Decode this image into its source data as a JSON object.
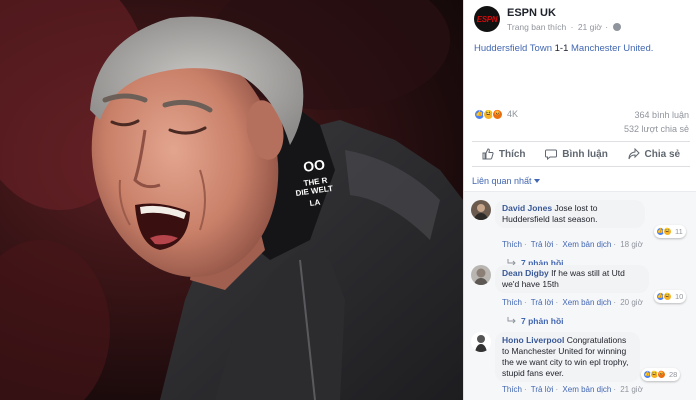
{
  "post": {
    "page_name": "ESPN UK",
    "logo_text": "ESPN",
    "meta_label": "Trang ban thích",
    "time": "21 giờ",
    "text_team1": "Huddersfield Town",
    "text_score": "1-1",
    "text_team2": "Manchester United.",
    "reaction_count": "4K",
    "comments_count": "364 bình luận",
    "shares_count": "532 lượt chia sẻ",
    "jacket_text_line1": "OO",
    "jacket_text_line2": "THE R",
    "jacket_text_line3": "DIE WELT",
    "jacket_text_line4": "LA"
  },
  "actions": {
    "like": "Thích",
    "comment": "Bình luận",
    "share": "Chia sẻ"
  },
  "sort_label": "Liên quan nhất",
  "comments": [
    {
      "author": "David Jones",
      "text": "Jose lost to Huddersfield last season.",
      "like": "Thích",
      "reply": "Trả lời",
      "translate": "Xem bản dịch",
      "time": "18 giờ",
      "reactions": "11",
      "replies_label": "7 phản hồi"
    },
    {
      "author": "Dean Digby",
      "text": "If he was still at Utd we'd have 15th",
      "like": "Thích",
      "reply": "Trả lời",
      "translate": "Xem bản dịch",
      "time": "20 giờ",
      "reactions": "10",
      "replies_label": "7 phản hồi"
    },
    {
      "author": "Hono Liverpool",
      "text": "Congratulations to Manchester United for winning the we want city to win epl trophy, stupid fans ever.",
      "like": "Thích",
      "reply": "Trả lời",
      "translate": "Xem bản dịch",
      "time": "21 giờ",
      "reactions": "28"
    }
  ],
  "colors": {
    "link": "#4267b2",
    "author": "#385898",
    "like_reaction": "#4d82ee",
    "haha_reaction": "#f7b125",
    "angry_reaction": "#e9710f",
    "espn_red": "#d50a0a"
  }
}
